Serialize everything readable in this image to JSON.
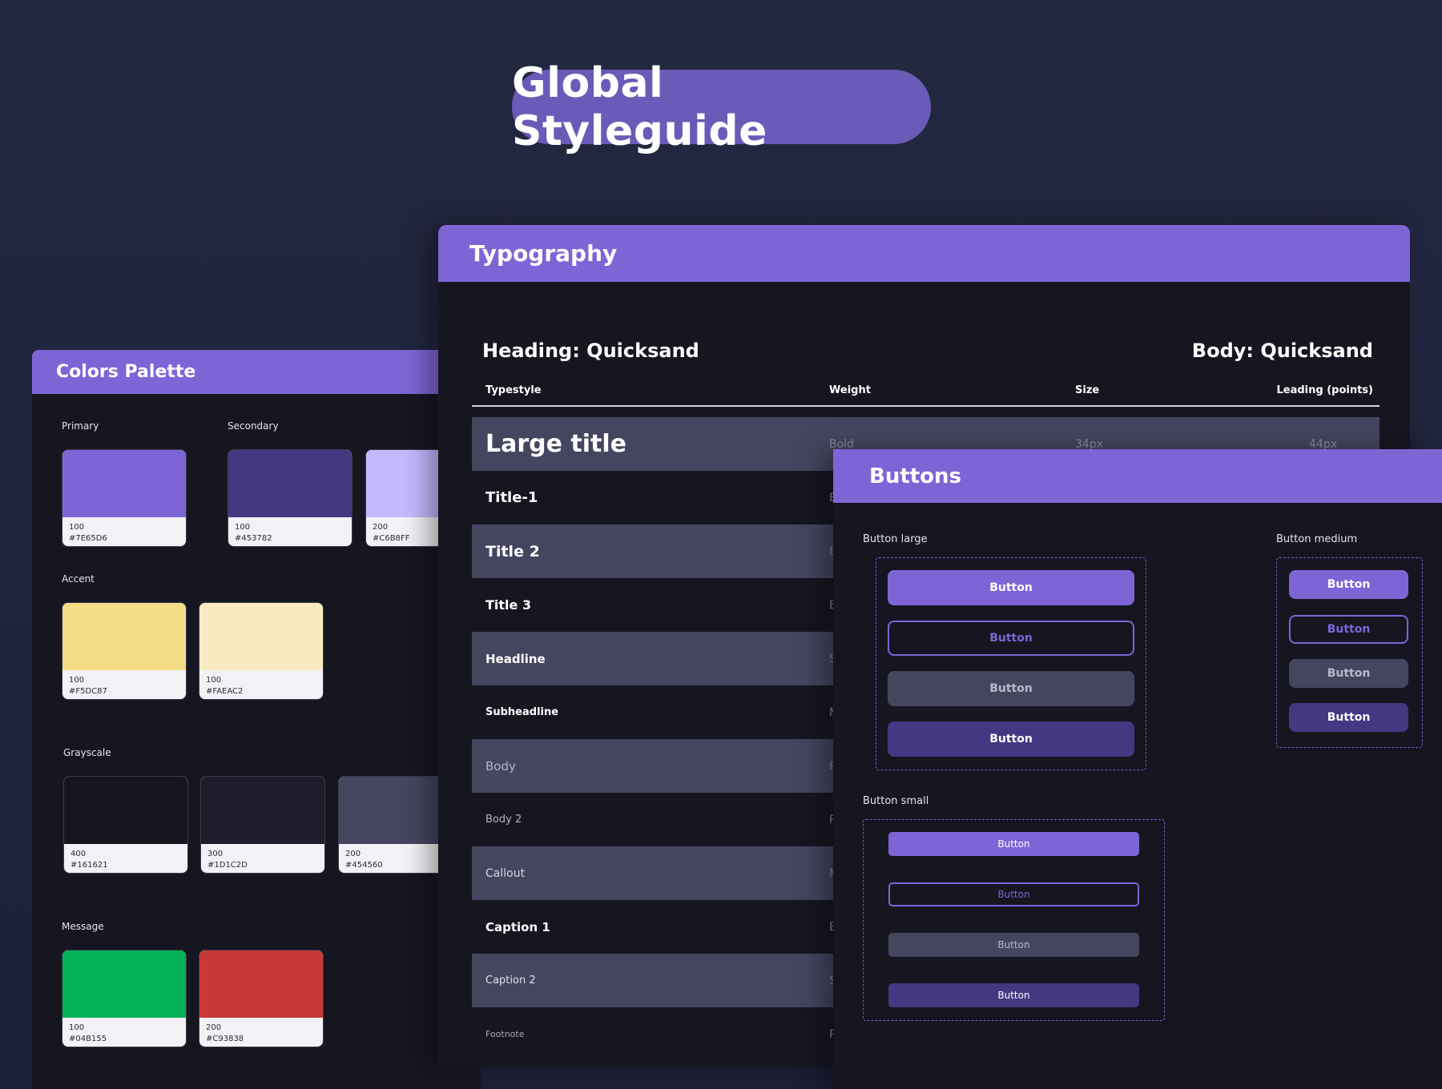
{
  "title": "Global Styleguide",
  "colors_palette": {
    "header": "Colors Palette",
    "groups": {
      "primary": {
        "label": "Primary",
        "swatches": [
          {
            "step": "100",
            "hex": "#7E65D6"
          }
        ]
      },
      "secondary": {
        "label": "Secondary",
        "swatches": [
          {
            "step": "100",
            "hex": "#453782"
          },
          {
            "step": "200",
            "hex": "#C6B8FF"
          }
        ]
      },
      "accent": {
        "label": "Accent",
        "swatches": [
          {
            "step": "100",
            "hex": "#F5DC87"
          },
          {
            "step": "100",
            "hex": "#FAEAC2"
          }
        ]
      },
      "grayscale": {
        "label": "Grayscale",
        "swatches": [
          {
            "step": "400",
            "hex": "#161621"
          },
          {
            "step": "300",
            "hex": "#1D1C2D"
          },
          {
            "step": "200",
            "hex": "#454560"
          }
        ]
      },
      "message": {
        "label": "Message",
        "swatches": [
          {
            "step": "100",
            "hex": "#04B155"
          },
          {
            "step": "200",
            "hex": "#C93838"
          }
        ]
      }
    }
  },
  "typography": {
    "header": "Typography",
    "heading_font": "Heading: Quicksand",
    "body_font": "Body: Quicksand",
    "columns": {
      "typestyle": "Typestyle",
      "weight": "Weight",
      "size": "Size",
      "leading": "Leading (points)"
    },
    "rows": [
      {
        "name": "Large title",
        "weight": "Bold",
        "size": "34px",
        "leading": "44px"
      },
      {
        "name": "Title-1",
        "weight": "B",
        "size": "",
        "leading": ""
      },
      {
        "name": "Title 2",
        "weight": "B",
        "size": "",
        "leading": ""
      },
      {
        "name": "Title 3",
        "weight": "B",
        "size": "",
        "leading": ""
      },
      {
        "name": "Headline",
        "weight": "S",
        "size": "",
        "leading": ""
      },
      {
        "name": "Subheadline",
        "weight": "M",
        "size": "",
        "leading": ""
      },
      {
        "name": "Body",
        "weight": "R",
        "size": "",
        "leading": ""
      },
      {
        "name": "Body 2",
        "weight": "R",
        "size": "",
        "leading": ""
      },
      {
        "name": "Callout",
        "weight": "M",
        "size": "",
        "leading": ""
      },
      {
        "name": "Caption 1",
        "weight": "B",
        "size": "",
        "leading": ""
      },
      {
        "name": "Caption 2",
        "weight": "S",
        "size": "",
        "leading": ""
      },
      {
        "name": "Footnote",
        "weight": "R",
        "size": "",
        "leading": ""
      }
    ]
  },
  "buttons": {
    "header": "Buttons",
    "large_label": "Button large",
    "medium_label": "Button medium",
    "small_label": "Button small",
    "button_text": "Button"
  }
}
